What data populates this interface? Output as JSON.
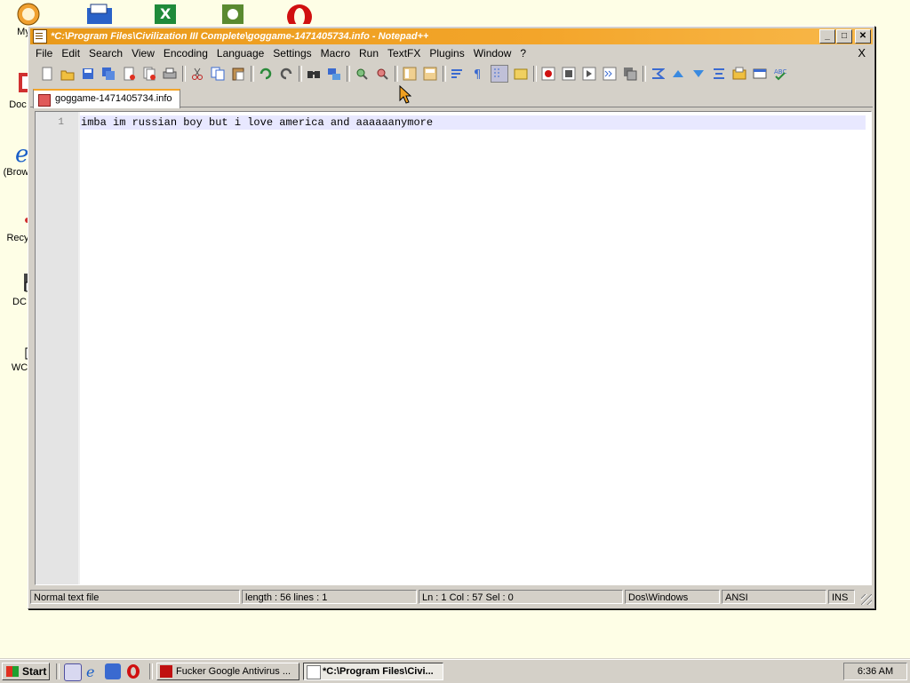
{
  "desktop": {
    "icons": [
      {
        "label": "My C",
        "icon": "my-computer-icon"
      },
      {
        "label": "Doc",
        "icon": "documents-icon"
      },
      {
        "label": "(Brow",
        "icon": "browser-icon"
      },
      {
        "label": "Recy",
        "icon": "recycle-bin-icon"
      },
      {
        "label": "DC",
        "icon": "shortcut-icon"
      },
      {
        "label": "WC",
        "icon": "shortcut-icon"
      }
    ]
  },
  "window": {
    "title": "*C:\\Program Files\\Civilization III Complete\\goggame-1471405734.info - Notepad++",
    "controls": {
      "minimize": "_",
      "maximize": "□",
      "close": "✕"
    }
  },
  "menubar": {
    "items": [
      "File",
      "Edit",
      "Search",
      "View",
      "Encoding",
      "Language",
      "Settings",
      "Macro",
      "Run",
      "TextFX",
      "Plugins",
      "Window",
      "?"
    ],
    "close_label": "X"
  },
  "toolbar": {
    "icons": [
      "new-file-icon",
      "open-file-icon",
      "save-icon",
      "save-all-icon",
      "close-icon",
      "close-all-icon",
      "print-icon",
      "cut-icon",
      "copy-icon",
      "paste-icon",
      "undo-icon",
      "redo-icon",
      "find-icon",
      "replace-icon",
      "zoom-in-icon",
      "zoom-out-icon",
      "sync-v-icon",
      "sync-h-icon",
      "word-wrap-icon",
      "show-all-chars-icon",
      "indent-guide-icon",
      "folder-icon",
      "record-macro-icon",
      "stop-macro-icon",
      "play-macro-icon",
      "run-macro-icon",
      "save-macro-icon",
      "collapse-icon",
      "up-icon",
      "down-icon",
      "expand-icon",
      "open-folder-icon",
      "panel-icon",
      "spellcheck-icon"
    ]
  },
  "tab": {
    "label": "goggame-1471405734.info"
  },
  "editor": {
    "line_number": "1",
    "text": "imba im russian boy but i love america and aaaaaanymore"
  },
  "statusbar": {
    "file_type": "Normal text file",
    "length": "length : 56    lines : 1",
    "position": "Ln : 1    Col : 57    Sel : 0",
    "eol": "Dos\\Windows",
    "encoding": "ANSI",
    "mode": "INS"
  },
  "taskbar": {
    "start_label": "Start",
    "tasks": [
      {
        "label": "Fucker Google Antivirus ...",
        "active": false
      },
      {
        "label": "*C:\\Program Files\\Civi...",
        "active": true
      }
    ],
    "clock": "6:36 AM"
  },
  "colors": {
    "desktop_bg": "#fefee6",
    "title_bar": "#f3a52a",
    "chrome": "#d4d0c8",
    "current_line": "#e8e8ff"
  }
}
